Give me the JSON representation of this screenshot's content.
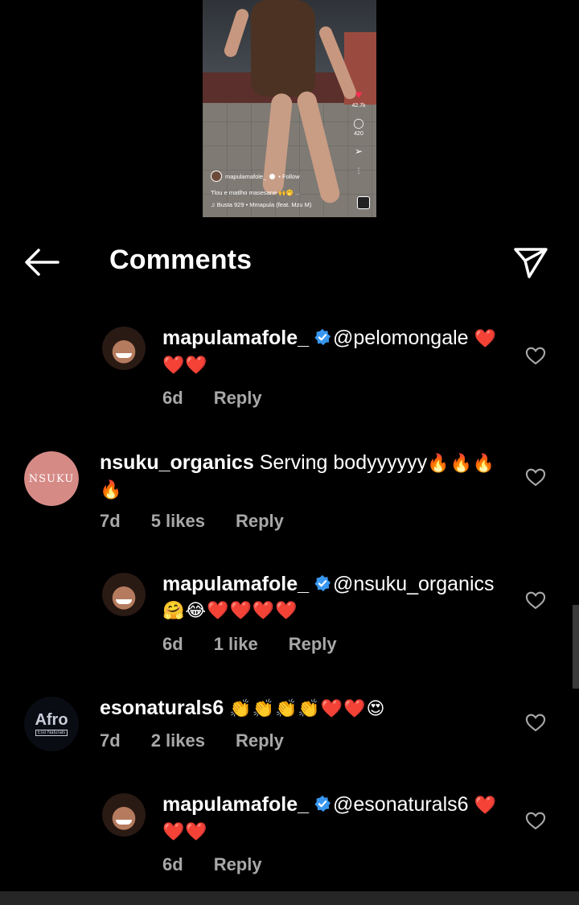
{
  "video": {
    "likes": "42.7k",
    "comments_count": "420",
    "username": "mapulamafole_",
    "follow_label": "• Follow",
    "caption": "Tlou e matlho masesane 🙌🤭 ...",
    "song": "♫ Busta 929 • Mmapula (feat. Mzu M)"
  },
  "header": {
    "title": "Comments"
  },
  "comments": [
    {
      "username": "mapulamafole_",
      "verified": true,
      "mention": "@pelomongale",
      "emojis_line1": "❤️",
      "emojis_line2": "❤️❤️",
      "time": "6d",
      "likes": "",
      "reply_label": "Reply"
    },
    {
      "username": "nsuku_organics",
      "verified": false,
      "text": "Serving bodyyyyyy",
      "emojis_line1": "🔥🔥🔥",
      "emojis_line2": "🔥",
      "time": "7d",
      "likes": "5 likes",
      "reply_label": "Reply",
      "avatar_text": "NSUKU"
    },
    {
      "username": "mapulamafole_",
      "verified": true,
      "mention": "@nsuku_organics",
      "emojis_line2": "🤗😂❤️❤️❤️❤️",
      "time": "6d",
      "likes": "1 like",
      "reply_label": "Reply"
    },
    {
      "username": "esonaturals6",
      "verified": false,
      "emojis_line1": "👏👏👏👏❤️❤️😍",
      "time": "7d",
      "likes": "2 likes",
      "reply_label": "Reply",
      "avatar_text": "Afro",
      "avatar_subtext": "Eso Naturals"
    },
    {
      "username": "mapulamafole_",
      "verified": true,
      "mention": "@esonaturals6",
      "emojis_line1": "❤️",
      "emojis_line2": "❤️❤️",
      "time": "6d",
      "likes": "",
      "reply_label": "Reply"
    }
  ],
  "colors": {
    "background": "#000000",
    "secondary_text": "#a8a8a8",
    "verified_blue": "#3897f0",
    "heart_red": "#ee1c2c"
  }
}
